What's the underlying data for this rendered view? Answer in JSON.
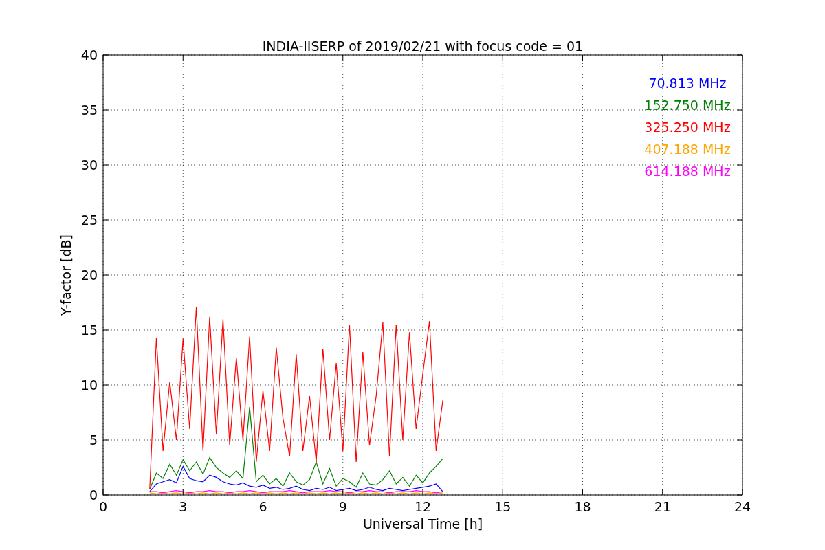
{
  "chart_data": {
    "type": "line",
    "title": "INDIA-IISERP of 2019/02/21 with focus code = 01",
    "xlabel": "Universal Time [h]",
    "ylabel": "Y-factor [dB]",
    "xlim": [
      0,
      24
    ],
    "ylim": [
      0,
      40
    ],
    "xticks": [
      0,
      3,
      6,
      9,
      12,
      15,
      18,
      21,
      24
    ],
    "yticks": [
      0,
      5,
      10,
      15,
      20,
      25,
      30,
      35,
      40
    ],
    "grid": true,
    "x": [
      1.75,
      2,
      2.25,
      2.5,
      2.75,
      3,
      3.25,
      3.5,
      3.75,
      4,
      4.25,
      4.5,
      4.75,
      5,
      5.25,
      5.5,
      5.75,
      6,
      6.25,
      6.5,
      6.75,
      7,
      7.25,
      7.5,
      7.75,
      8,
      8.25,
      8.5,
      8.75,
      9,
      9.25,
      9.5,
      9.75,
      10,
      10.25,
      10.5,
      10.75,
      11,
      11.25,
      11.5,
      11.75,
      12,
      12.25,
      12.5,
      12.75
    ],
    "series": [
      {
        "name": "70.813 MHz",
        "color": "#0000ff",
        "values": [
          0.3,
          1.0,
          1.2,
          1.4,
          1.1,
          2.6,
          1.5,
          1.3,
          1.2,
          1.8,
          1.6,
          1.2,
          1.0,
          0.9,
          1.1,
          0.8,
          0.7,
          0.9,
          0.6,
          0.7,
          0.5,
          0.6,
          0.8,
          0.5,
          0.4,
          0.6,
          0.5,
          0.7,
          0.4,
          0.5,
          0.6,
          0.4,
          0.5,
          0.7,
          0.5,
          0.4,
          0.6,
          0.5,
          0.4,
          0.5,
          0.6,
          0.7,
          0.8,
          1.0,
          0.3
        ]
      },
      {
        "name": "152.750 MHz",
        "color": "#008000",
        "values": [
          0.5,
          2.0,
          1.5,
          2.8,
          1.8,
          3.2,
          2.2,
          3.0,
          1.9,
          3.4,
          2.5,
          2.0,
          1.6,
          2.2,
          1.5,
          8.0,
          1.2,
          1.8,
          1.0,
          1.5,
          0.8,
          2.0,
          1.2,
          0.9,
          1.4,
          3.0,
          1.0,
          2.4,
          0.8,
          1.5,
          1.2,
          0.7,
          2.0,
          1.0,
          0.9,
          1.4,
          2.2,
          1.0,
          1.6,
          0.8,
          1.8,
          1.1,
          2.0,
          2.6,
          3.3
        ]
      },
      {
        "name": "325.250 MHz",
        "color": "#ff0000",
        "values": [
          0.5,
          14.3,
          4.0,
          10.3,
          5.0,
          14.2,
          6.0,
          17.1,
          4.0,
          16.2,
          5.5,
          16.0,
          4.5,
          12.5,
          5.0,
          14.4,
          3.0,
          9.5,
          4.0,
          13.4,
          7.0,
          3.5,
          12.8,
          4.0,
          9.0,
          3.0,
          13.3,
          5.0,
          12.0,
          4.0,
          15.5,
          3.0,
          13.0,
          4.5,
          9.0,
          15.7,
          3.5,
          15.5,
          5.0,
          14.8,
          6.0,
          11.0,
          15.8,
          4.0,
          8.6
        ]
      },
      {
        "name": "407.188 MHz",
        "color": "#ffa500",
        "values": [
          0.2,
          0.1,
          0.2,
          0.1,
          0.2,
          0.1,
          0.2,
          0.1,
          0.2,
          0.1,
          0.2,
          0.1,
          0.2,
          0.1,
          0.2,
          0.1,
          0.2,
          0.1,
          0.2,
          0.1,
          0.2,
          0.1,
          0.2,
          0.1,
          0.2,
          0.1,
          0.2,
          0.1,
          0.2,
          0.1,
          0.2,
          0.1,
          0.2,
          0.1,
          0.2,
          0.1,
          0.2,
          0.1,
          0.2,
          0.1,
          0.2,
          0.1,
          0.2,
          0.1,
          0.2
        ]
      },
      {
        "name": "614.188 MHz",
        "color": "#ff00ff",
        "values": [
          0.3,
          0.3,
          0.2,
          0.3,
          0.4,
          0.3,
          0.2,
          0.3,
          0.3,
          0.4,
          0.3,
          0.3,
          0.2,
          0.3,
          0.3,
          0.4,
          0.3,
          0.2,
          0.3,
          0.3,
          0.3,
          0.4,
          0.3,
          0.2,
          0.3,
          0.3,
          0.3,
          0.4,
          0.3,
          0.3,
          0.2,
          0.3,
          0.3,
          0.4,
          0.3,
          0.3,
          0.2,
          0.3,
          0.3,
          0.3,
          0.4,
          0.3,
          0.3,
          0.2,
          0.3
        ]
      }
    ]
  }
}
